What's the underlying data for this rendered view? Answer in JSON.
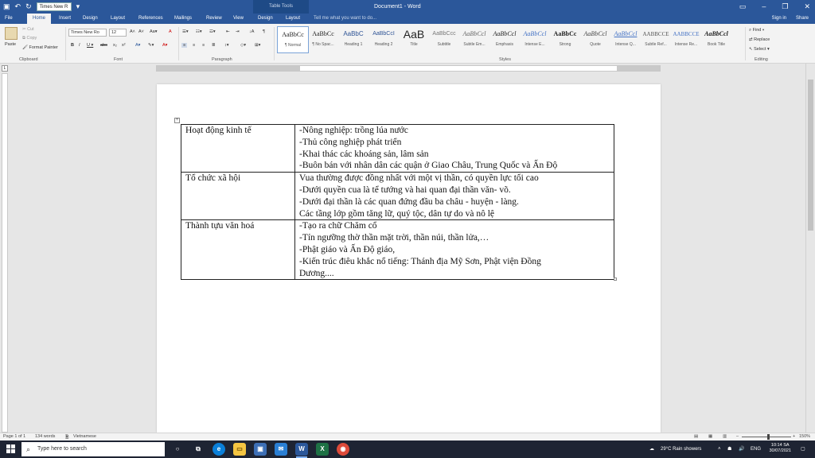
{
  "titlebar": {
    "font_box": "Times New R",
    "table_tools": "Table Tools",
    "doc_title": "Document1 - Word",
    "sign_in": "Sign in",
    "share": "Share"
  },
  "tabs": [
    "File",
    "Home",
    "Insert",
    "Design",
    "Layout",
    "References",
    "Mailings",
    "Review",
    "View",
    "Design",
    "Layout"
  ],
  "tell_me": "Tell me what you want to do...",
  "ribbon": {
    "clipboard": {
      "paste": "Paste",
      "cut": "Cut",
      "copy": "Copy",
      "format_painter": "Format Painter",
      "label": "Clipboard"
    },
    "font": {
      "name": "Times New Ro",
      "size": "12",
      "label": "Font"
    },
    "paragraph_label": "Paragraph",
    "styles_label": "Styles",
    "styles": [
      {
        "preview": "AaBbCc",
        "name": "¶ Normal"
      },
      {
        "preview": "AaBbCc",
        "name": "¶ No Spac..."
      },
      {
        "preview": "AaBbC",
        "name": "Heading 1"
      },
      {
        "preview": "AaBbCcI",
        "name": "Heading 2"
      },
      {
        "preview": "AaB",
        "name": "Title"
      },
      {
        "preview": "AaBbCcc",
        "name": "Subtitle"
      },
      {
        "preview": "AaBbCcl",
        "name": "Subtle Em..."
      },
      {
        "preview": "AaBbCcl",
        "name": "Emphasis"
      },
      {
        "preview": "AaBbCcl",
        "name": "Intense E..."
      },
      {
        "preview": "AaBbCc",
        "name": "Strong"
      },
      {
        "preview": "AaBbCcl",
        "name": "Quote"
      },
      {
        "preview": "AaBbCcl",
        "name": "Intense Q..."
      },
      {
        "preview": "AABBCCE",
        "name": "Subtle Ref..."
      },
      {
        "preview": "AABBCCE",
        "name": "Intense Re..."
      },
      {
        "preview": "AaBbCcl",
        "name": "Book Title"
      }
    ],
    "editing": {
      "find": "Find",
      "replace": "Replace",
      "select": "Select",
      "label": "Editing"
    }
  },
  "document": {
    "rows": [
      {
        "heading": "Hoạt động kinh tế",
        "lines": [
          "-Nông nghiệp:  trồng lúa nước",
          "-Thủ công nghiệp phát triển",
          "-Khai thác các khoáng sản, lâm sản",
          "-Buôn bán với  nhân dân các quận ở Giao Châu, Trung Quốc và Ấn Độ"
        ]
      },
      {
        "heading": "Tổ chức xã hội",
        "lines": [
          "Vua thường được đồng nhất với một vị thần, có quyền lực tối cao",
          "-Dưới quyền cua là tể tướng và hai quan đại thần văn- võ.",
          "-Dưới đại thần là các quan đứng đầu ba châu - huyện - làng.",
          "Các tầng lớp gồm tăng lữ, quý tộc, dân tự do và nô lệ"
        ]
      },
      {
        "heading": "Thành tựu văn hoá",
        "lines": [
          "-Tạo ra chữ Chăm cổ",
          "-Tín ngưỡng thờ thần mặt trời, thần núi, thần lửa,…",
          "-Phật giáo và Ấn Độ giáo,",
          "-Kiến trúc điêu khắc nổ tiếng: Thánh địa Mỹ Sơn, Phật viện Đồng",
          "Dương...."
        ]
      }
    ]
  },
  "status": {
    "page": "Page 1 of 1",
    "words": "134 words",
    "language": "Vietnamese",
    "zoom": "150%"
  },
  "taskbar": {
    "search_placeholder": "Type here to search",
    "weather": "29°C  Rain showers",
    "lang": "ENG",
    "time": "10:14 SA",
    "date": "30/07/2021"
  }
}
